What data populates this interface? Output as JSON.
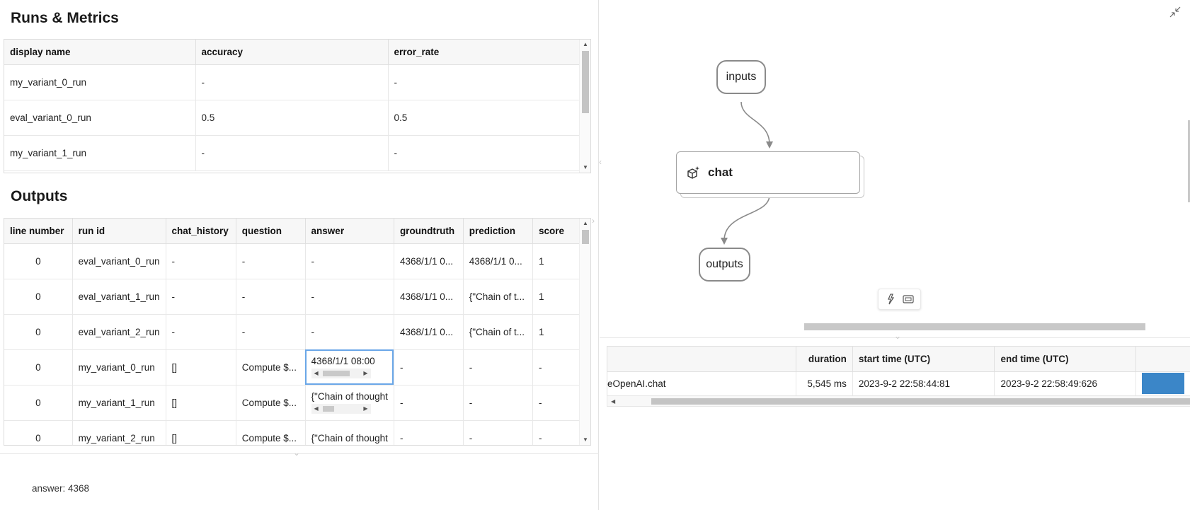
{
  "runs_metrics": {
    "title": "Runs & Metrics",
    "columns": [
      "display name",
      "accuracy",
      "error_rate"
    ],
    "rows": [
      [
        "my_variant_0_run",
        "-",
        "-"
      ],
      [
        "eval_variant_0_run",
        "0.5",
        "0.5"
      ],
      [
        "my_variant_1_run",
        "-",
        "-"
      ]
    ]
  },
  "outputs": {
    "title": "Outputs",
    "columns": [
      "line number",
      "run id",
      "chat_history",
      "question",
      "answer",
      "groundtruth",
      "prediction",
      "score"
    ],
    "rows": [
      [
        "0",
        "eval_variant_0_run",
        "-",
        "-",
        "-",
        "4368/1/1 0...",
        "4368/1/1 0...",
        "1"
      ],
      [
        "0",
        "eval_variant_1_run",
        "-",
        "-",
        "-",
        "4368/1/1 0...",
        "{\"Chain of t...",
        "1"
      ],
      [
        "0",
        "eval_variant_2_run",
        "-",
        "-",
        "-",
        "4368/1/1 0...",
        "{\"Chain of t...",
        "1"
      ],
      [
        "0",
        "my_variant_0_run",
        "[]",
        "Compute $...",
        "4368/1/1 08:00",
        "-",
        "-",
        "-"
      ],
      [
        "0",
        "my_variant_1_run",
        "[]",
        "Compute $...",
        "{\"Chain of thought",
        "-",
        "-",
        "-"
      ],
      [
        "0",
        "my_variant_2_run",
        "[]",
        "Compute $...",
        "{\"Chain of thought",
        "-",
        "-",
        "-"
      ]
    ]
  },
  "detail": {
    "answer_text": "answer: 4368"
  },
  "flow_graph": {
    "input_node": "inputs",
    "llm_node": "chat",
    "output_node": "outputs"
  },
  "trace": {
    "columns": [
      "",
      "duration",
      "start time (UTC)",
      "end time (UTC)",
      ""
    ],
    "rows": [
      [
        "eOpenAI.chat",
        "5,545 ms",
        "2023-9-2 22:58:44:81",
        "2023-9-2 22:58:49:626"
      ]
    ],
    "bar_color": "#3b86c8"
  },
  "colors": {
    "selection": "#6aa7e8",
    "node_border": "#8a8a8a"
  }
}
